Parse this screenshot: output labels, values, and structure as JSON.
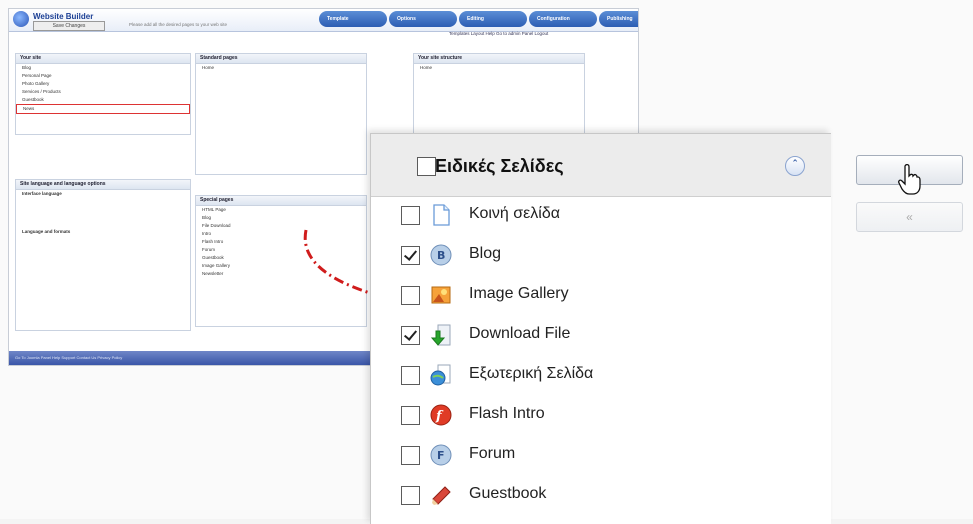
{
  "app": {
    "brand": "Website Builder",
    "save_label": "Save Changes",
    "hint": "Please add all the desired pages to your web site",
    "steps": [
      "Template",
      "Options",
      "Editing",
      "Configuration",
      "Publishing"
    ],
    "links": "Templates  Layout  Help  Go to admin Panel  Logout",
    "your_site": {
      "title": "Your site",
      "items": [
        "Blog",
        "Personal Page",
        "Photo Gallery",
        "Services / Products",
        "Guestbook",
        "News"
      ]
    },
    "standard_pages": {
      "title": "Standard pages",
      "items": [
        "Home"
      ]
    },
    "site_structure": {
      "title": "Your site structure",
      "items": [
        "Home"
      ]
    },
    "special_pages": {
      "title": "Special pages",
      "items": [
        "HTML Page",
        "Blog",
        "File Download",
        "Intro",
        "Flash Intro",
        "Forum",
        "Guestbook",
        "Image Gallery",
        "Newsletter"
      ]
    },
    "language": {
      "title": "Site language and language options",
      "lines": [
        "Interface language",
        "Language and formats"
      ]
    },
    "footer": "Go To Joomla Panel  Help  Support  Contact Us  Privacy Policy"
  },
  "zoom": {
    "title": "Ειδικές Σελίδες",
    "items": [
      {
        "label": "Κοινή σελίδα",
        "checked": false,
        "icon": "page-icon"
      },
      {
        "label": "Blog",
        "checked": true,
        "icon": "blog-icon"
      },
      {
        "label": "Image Gallery",
        "checked": false,
        "icon": "image-gallery-icon"
      },
      {
        "label": "Download File",
        "checked": true,
        "icon": "download-icon"
      },
      {
        "label": "Εξωτερική Σελίδα",
        "checked": false,
        "icon": "external-page-icon"
      },
      {
        "label": "Flash Intro",
        "checked": false,
        "icon": "flash-icon"
      },
      {
        "label": "Forum",
        "checked": false,
        "icon": "forum-icon"
      },
      {
        "label": "Guestbook",
        "checked": false,
        "icon": "guestbook-icon"
      }
    ]
  },
  "side_buttons": {
    "add_label": "",
    "remove_label": "«"
  }
}
